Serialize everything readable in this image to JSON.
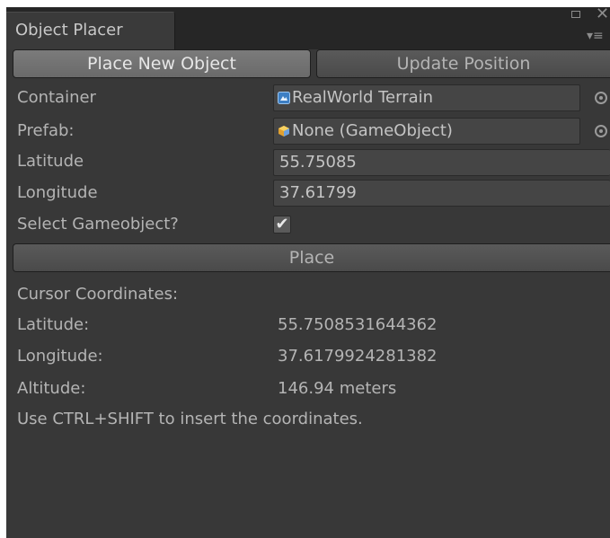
{
  "window": {
    "tab_title": "Object Placer",
    "icons": [
      "maximize-icon",
      "close-icon",
      "menu-icon"
    ]
  },
  "mode_buttons": {
    "place_new": "Place New Object",
    "update_position": "Update Position",
    "active": "place_new"
  },
  "form": {
    "container_label": "Container",
    "container_value": "RealWorld Terrain",
    "container_icon": "terrain-icon",
    "prefab_label": "Prefab:",
    "prefab_value": "None (GameObject)",
    "prefab_icon": "gameobject-icon",
    "latitude_label": "Latitude",
    "latitude_value": "55.75085",
    "longitude_label": "Longitude",
    "longitude_value": "37.61799",
    "select_label": "Select Gameobject?",
    "select_checked": true,
    "select_glyph": "✔"
  },
  "place_button": "Place",
  "cursor": {
    "heading": "Cursor Coordinates:",
    "latitude_label": "Latitude:",
    "latitude_value": "55.7508531644362",
    "longitude_label": "Longitude:",
    "longitude_value": "37.6179924281382",
    "altitude_label": "Altitude:",
    "altitude_value": "146.94 meters",
    "hint": "Use CTRL+SHIFT to insert the coordinates."
  },
  "colors": {
    "panel_bg": "#383838",
    "tabbar_bg": "#262626",
    "text": "#b4b4b4",
    "active_button": "#7b7b7b"
  }
}
